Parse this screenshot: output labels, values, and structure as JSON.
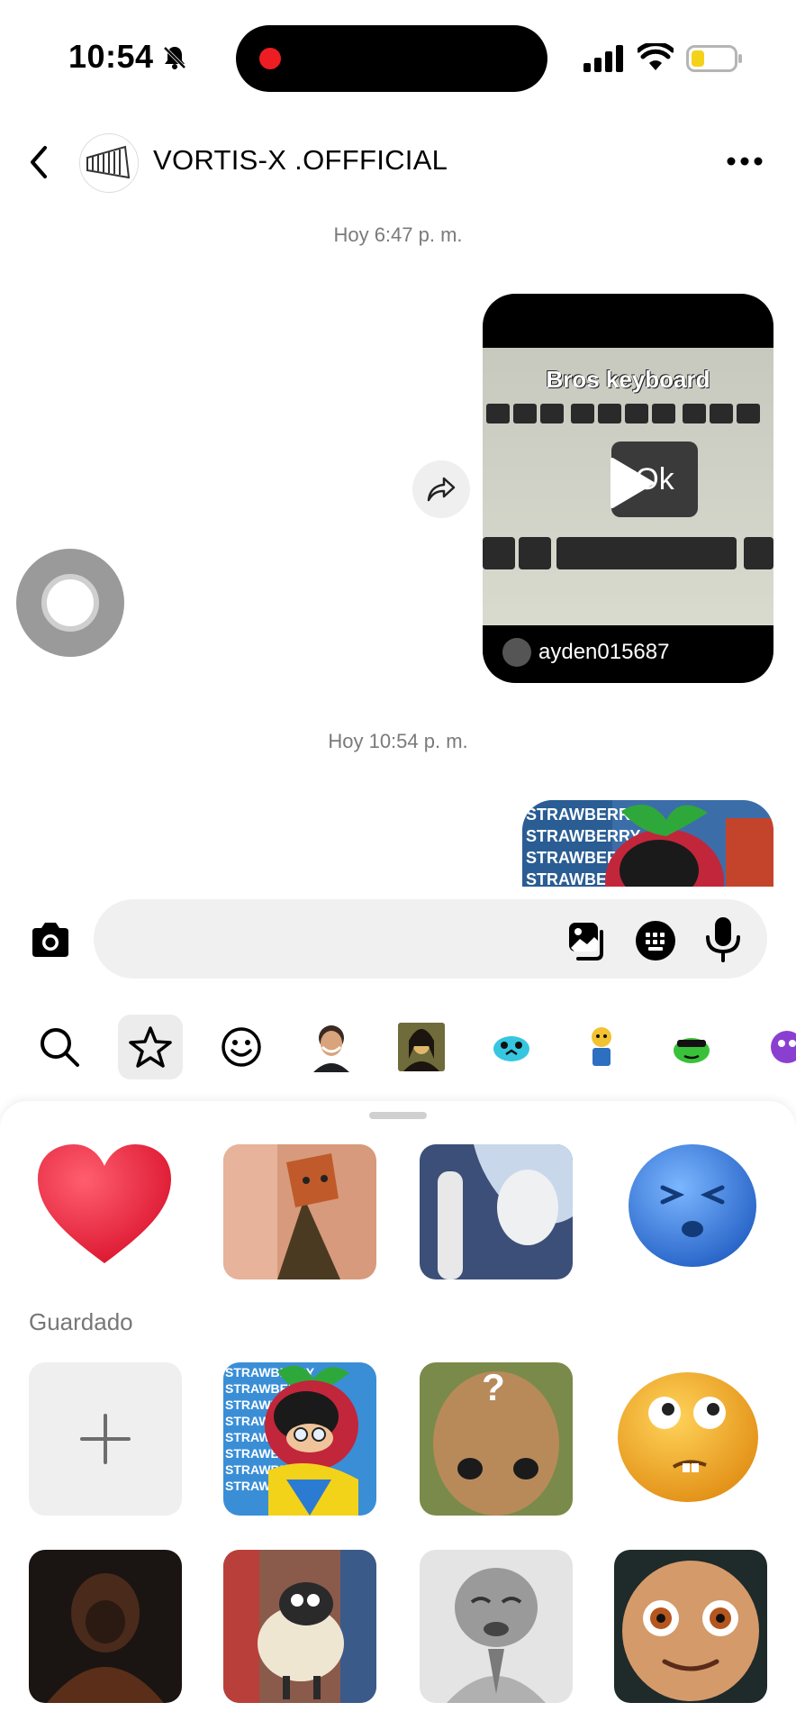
{
  "status_bar": {
    "time": "10:54"
  },
  "header": {
    "back_label": "‹",
    "title": "VORTIS-X .OFFFICIAL",
    "more_label": "•••"
  },
  "messages": {
    "timestamp_1": "Hoy 6:47 p. m.",
    "video": {
      "caption": "Bros keyboard",
      "key_text": "Ok",
      "user": "ayden015687"
    },
    "timestamp_2": "Hoy 10:54 p. m.",
    "sticker_text": "STRAWBERRY"
  },
  "stickers": {
    "section_saved": "Guardado",
    "add_label": "+"
  },
  "colors": {
    "accent": "#0a0a0a",
    "record": "#ee1d23",
    "battery": "#f5d21a"
  }
}
